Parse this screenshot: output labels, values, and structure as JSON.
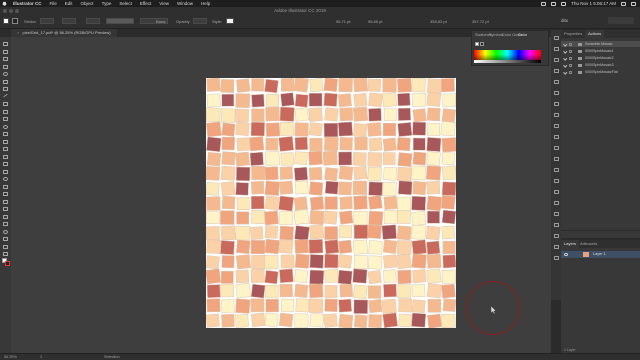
{
  "menubar": {
    "items": [
      "Illustrator CC",
      "File",
      "Edit",
      "Object",
      "Type",
      "Select",
      "Effect",
      "View",
      "Window",
      "Help"
    ],
    "clock": "Thu Nov 1  5:06:17 AM",
    "user": "ditx"
  },
  "window": {
    "title": "Adobe Illustrator CC 2019"
  },
  "controlbar": {
    "stroke_label": "Stroke:",
    "brush_label": "Basic",
    "opacity_label": "Opacity:",
    "style_label": "Style:",
    "x_value": "95.71 pt",
    "y_value": "95.85 pt",
    "w_value": "358.83 pt",
    "h_value": "357.72 pt",
    "user": "ditx",
    "colors": {
      "fill": "#ffffff",
      "stroke_mark": "#e03030"
    }
  },
  "document": {
    "tab_label": "pixelGrid_17.pdf* @ 56.25% (RGB/GPU Preview)"
  },
  "tools": [
    "selection-tool",
    "direct-selection-tool",
    "magic-wand-tool",
    "lasso-tool",
    "pen-tool",
    "curvature-tool",
    "type-tool",
    "line-tool",
    "rectangle-tool",
    "paintbrush-tool",
    "shaper-tool",
    "pencil-tool",
    "eraser-tool",
    "rotate-tool",
    "scale-tool",
    "width-tool",
    "free-transform-tool",
    "shape-builder-tool",
    "perspective-grid-tool",
    "mesh-tool",
    "gradient-tool",
    "eyedropper-tool",
    "blend-tool",
    "symbol-sprayer-tool",
    "column-graph-tool",
    "artboard-tool",
    "slice-tool",
    "hand-tool",
    "zoom-tool"
  ],
  "color_panel": {
    "tabs": [
      "Swatches",
      "Symbols",
      "Color Guide",
      "Color"
    ],
    "active_tab": "Color"
  },
  "actions_panel": {
    "tabs": [
      "Properties",
      "Actions"
    ],
    "active_tab": "Actions",
    "items": [
      {
        "name": "Scramble Mosaic",
        "selected": true
      },
      {
        "name": "0000SpinMosaic1",
        "selected": false
      },
      {
        "name": "0000SpinMosaic2",
        "selected": false
      },
      {
        "name": "0000SpinMosaic3",
        "selected": false
      },
      {
        "name": "0000SpinMosaicFlat",
        "selected": false
      }
    ]
  },
  "layers_panel": {
    "tabs": [
      "Layers",
      "Artboards"
    ],
    "active_tab": "Layers",
    "layer_name": "Layer 1",
    "count_label": "1 Layer"
  },
  "artwork": {
    "palette": [
      "#f0a57e",
      "#f5b990",
      "#fbd2a7",
      "#fde8b8",
      "#fff4c8",
      "#e8957a",
      "#c96a5c",
      "#a8585a"
    ]
  },
  "statusbar": {
    "zoom": "56.25%",
    "artboard": "1",
    "tool_label": "Selection"
  }
}
